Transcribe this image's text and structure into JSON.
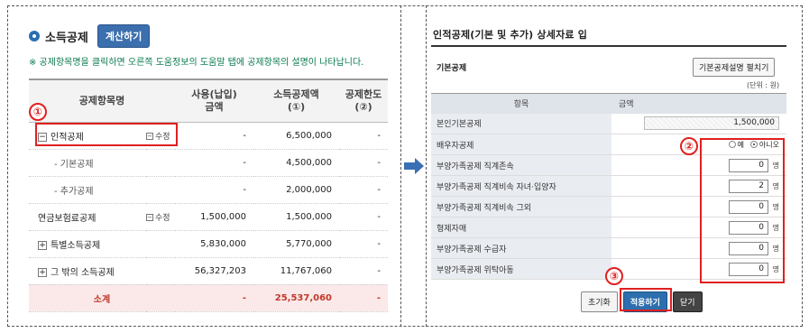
{
  "left": {
    "title": "소득공제",
    "calc_button": "계산하기",
    "notice": "※ 공제항목명을 클릭하면 오른쪽 도움정보의 도움말 탭에 공제항목의 설명이 나타납니다.",
    "headers": [
      "공제항목명",
      "",
      "사용(납입)\n금액",
      "소득공제액\n(①)",
      "공제한도\n(②)"
    ],
    "rows": [
      {
        "name": "인적공제",
        "toggle": "⊟",
        "edit": "수정",
        "amount": "-",
        "deduction": "6,500,000",
        "limit": "-"
      },
      {
        "name": "- 기본공제",
        "toggle": "",
        "edit": "",
        "amount": "-",
        "deduction": "4,500,000",
        "limit": "-"
      },
      {
        "name": "- 추가공제",
        "toggle": "",
        "edit": "",
        "amount": "-",
        "deduction": "2,000,000",
        "limit": "-"
      },
      {
        "name": "연금보험료공제",
        "toggle": "",
        "edit": "수정",
        "amount": "1,500,000",
        "deduction": "1,500,000",
        "limit": "-"
      },
      {
        "name": "특별소득공제",
        "toggle": "+",
        "edit": "",
        "amount": "5,830,000",
        "deduction": "5,770,000",
        "limit": "-"
      },
      {
        "name": "그 밖의 소득공제",
        "toggle": "+",
        "edit": "",
        "amount": "56,327,203",
        "deduction": "11,767,060",
        "limit": "-"
      }
    ],
    "total": {
      "name": "소계",
      "amount": "-",
      "deduction": "25,537,060",
      "limit": "-"
    }
  },
  "markers": {
    "one": "①",
    "two": "②",
    "three": "③"
  },
  "right": {
    "title": "인적공제(기본 및 추가) 상세자료 입",
    "section": "기본공제",
    "section_button": "기본공제설명 펼치기",
    "unit": "(단위 : 원)",
    "col_item": "항목",
    "col_amount": "금액",
    "rows": [
      {
        "label": "본인기본공제",
        "value": "1,500,000",
        "unit": ""
      },
      {
        "label": "배우자공제",
        "value": "",
        "unit": ""
      },
      {
        "label": "부양가족공제 직계존속",
        "value": "0",
        "unit": "명"
      },
      {
        "label": "부양가족공제 직계비속 자녀·입양자",
        "value": "2",
        "unit": "명"
      },
      {
        "label": "부양가족공제 직계비속 그외",
        "value": "0",
        "unit": "명"
      },
      {
        "label": "형제자매",
        "value": "0",
        "unit": "명"
      },
      {
        "label": "부양가족공제 수급자",
        "value": "0",
        "unit": "명"
      },
      {
        "label": "부양가족공제 위탁아동",
        "value": "0",
        "unit": "명"
      }
    ],
    "spouse_yes": "예",
    "spouse_no": "아니오",
    "buttons": {
      "reset": "초기화",
      "apply": "적용하기",
      "close": "닫기"
    }
  },
  "colors": {
    "accent": "#2d6fae",
    "highlight": "#e02020",
    "notice": "#0a7a4f"
  }
}
